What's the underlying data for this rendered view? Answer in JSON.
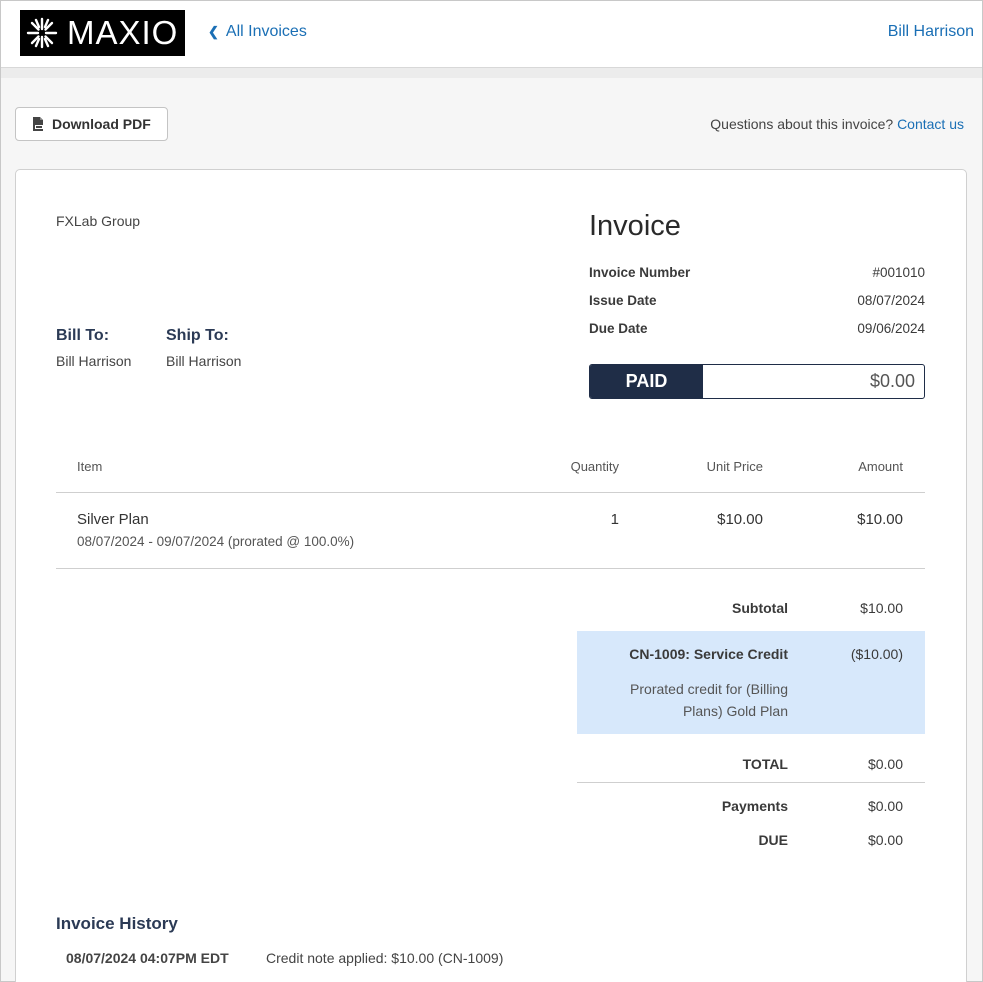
{
  "header": {
    "brand": "MAXIO",
    "back_label": "All Invoices",
    "user_name": "Bill Harrison"
  },
  "actions": {
    "download_pdf": "Download PDF",
    "questions_text": "Questions about this invoice?",
    "contact_link": "Contact us"
  },
  "invoice": {
    "company": "FXLab Group",
    "title": "Invoice",
    "meta": [
      {
        "label": "Invoice Number",
        "value": "#001010"
      },
      {
        "label": "Issue Date",
        "value": "08/07/2024"
      },
      {
        "label": "Due Date",
        "value": "09/06/2024"
      }
    ],
    "bill_to_label": "Bill To:",
    "bill_to_name": "Bill Harrison",
    "ship_to_label": "Ship To:",
    "ship_to_name": "Bill Harrison",
    "status": "PAID",
    "balance": "$0.00"
  },
  "items_table": {
    "headers": {
      "item": "Item",
      "quantity": "Quantity",
      "unit_price": "Unit Price",
      "amount": "Amount"
    },
    "rows": [
      {
        "name": "Silver Plan",
        "period": "08/07/2024 - 09/07/2024 (prorated @ 100.0%)",
        "quantity": "1",
        "unit_price": "$10.00",
        "amount": "$10.00"
      }
    ]
  },
  "totals": {
    "subtotal_label": "Subtotal",
    "subtotal_value": "$10.00",
    "credit_label": "CN-1009: Service Credit",
    "credit_value": "($10.00)",
    "credit_desc_line1": "Prorated credit for (Billing",
    "credit_desc_line2": "Plans) Gold Plan",
    "total_label": "TOTAL",
    "total_value": "$0.00",
    "payments_label": "Payments",
    "payments_value": "$0.00",
    "due_label": "DUE",
    "due_value": "$0.00"
  },
  "history": {
    "title": "Invoice History",
    "entries": [
      {
        "date": "08/07/2024 04:07PM EDT",
        "text": "Credit note applied: $10.00 (CN-1009)"
      }
    ]
  },
  "colors": {
    "brand_black": "#000000",
    "link_blue": "#1a6fb5",
    "navy": "#1f2d47",
    "credit_bg": "#d7e8fb"
  }
}
